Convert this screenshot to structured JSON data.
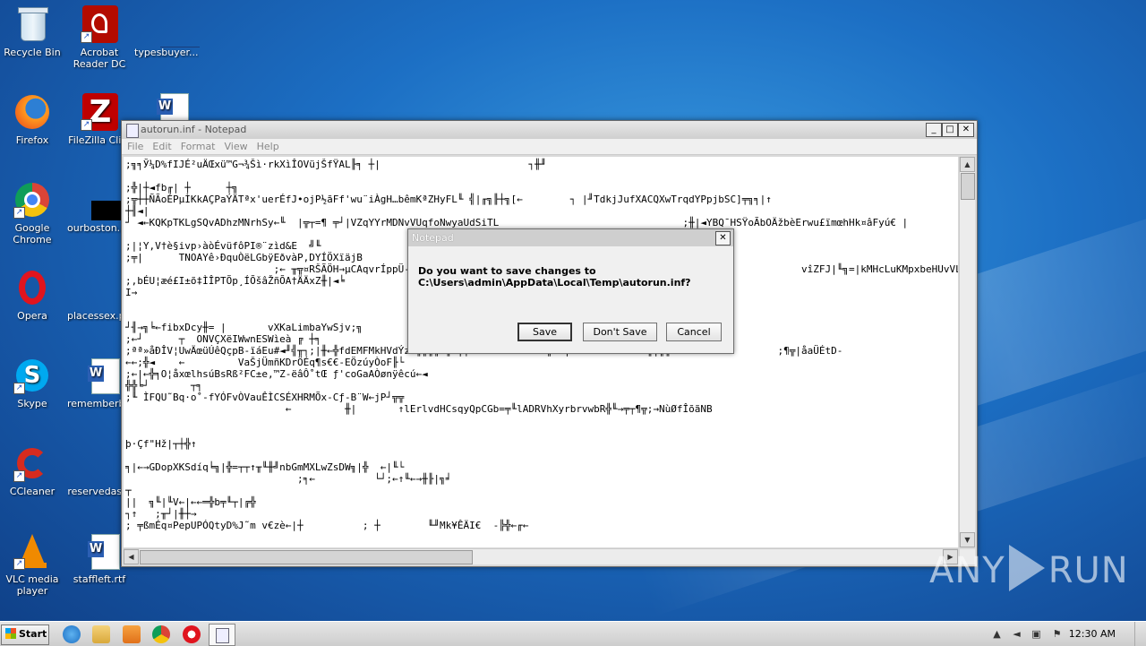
{
  "desktop": {
    "icons": [
      {
        "label": "Recycle Bin"
      },
      {
        "label": "Acrobat Reader DC"
      },
      {
        "label": "typesbuyer...."
      },
      {
        "label": "Firefox"
      },
      {
        "label": "FileZilla Cli..."
      },
      {
        "label": "Google Chrome"
      },
      {
        "label": "ourboston.r..."
      },
      {
        "label": "Opera"
      },
      {
        "label": "placessex.p..."
      },
      {
        "label": "Skype"
      },
      {
        "label": "rememberb..."
      },
      {
        "label": "CCleaner"
      },
      {
        "label": "reservedas..."
      },
      {
        "label": "VLC media player"
      },
      {
        "label": "staffleft.rtf"
      }
    ]
  },
  "notepad": {
    "title": "autorun.inf - Notepad",
    "menu": [
      "File",
      "Edit",
      "Format",
      "View",
      "Help"
    ],
    "content": ";╗╕Ў¼D%fIJÉ²uÄŒxü™G¬¾Šì·rkXìÎOVüjŠfŸAL╟╕ ┼|                         ┐╫╜\n\n;╬|┼◄fb╓| ┼      ┼╗\n;╦┼┼ÑÃoÉPµÌKkAÇPaÝÄTªx'uerÉfJ•ojP½ãFf'wu¨iÀgH…bêmKªZHyFL╙ ╣|╓╗╟┼╗[←        ┐ |╜TdkjJufXACQXwTrqdYPpjbSC]╤╗╕|↑\n┼╢◄|\n┘ ◄←KQKpTKLgSQvADhzMNrhSy←╙  |╦┬=¶ ╤┘|VZqYYrMDNvVUqfoNwyaUdSiTL                               ;╫|◄YBQ¯HSŸoÃbOÄžbèErwu£ïmœhHk¤âFyú€ |\n\n;|¦Y,V†è§ivp›àòÉvüfôPI®¨zìd&E  ╝╙\n;╤|      TNOAYê›ÐquÒëLGbÿEðvàP,DYÍÖXïäjB\n                         ;← ╥╦¤RŠÃÖH→µCAqvrÍppÜ-†EÑ                                                               vîZFJ|╙╗=|kMHcLuKMpxbeHUvVLDm╜\n;,bÉU¦æé£I±õ‡ÌÎPTÕp¸ÍÕšâŽñÕA†ÄÄxZ╫|◄╘\nI→\n\n\n┘╢→╗╘←fibxDcy╫= |       vXKaLimbaYwSjv;╗\n;←┘      ┬  ONVÇXëIWwnESWìeà ╔ ┼╕\n;ªª»åÐÎV¦UwÄœüÚêQçpB-ïáEu#◄╜╣╥┐;|╫←╬fdEMFMkHVdÝzE╫╣╫╬ ╬←|╤hNkoIumHmuk←◄╗ ←|=  →◄╜╜YeTJ←←╟|╗╥                  ;¶╦|åaÜÉtD-\n←←;╬◄    ←         VaŠjÜmñKDrÖÉq¶s€€-EÖzúyÒoF╟└\n;←|←╬╕O¦åxœlhsúBsRß²FC±e,™Z-ëâÔ˚tŒ ƒ'coGaAÒønÿêcú←◄\n╬╬╘┘       ┬╕\n;╙ ÌFQU˜Bq·o˚-fYÓFvÒVauÊÌCSÉXHRMÕx-Cƒ-B¨W←jP┘╦╦\n                           ←         ╫|       ↑lErlvdHCsqyQpCGb=╤╙lADRVhXyrbrvwbR╬╙→╤┬¶╦;→NùØfÎõãNB\n\n\nþ·Çf\"Hž|┬┼╬↑\n\n╕|←→GDopXKSdíq╘╗|╬=┬┬↑╥╙╫╝nbGmMXLwZsDW╗|╬  ←|╙└\n                             ;╕←          └┘;←↑╙←→╫╟|╗╛\n┬\n||  ╗╙|╙V←|←←═╬b╤╙┬|╔╬\n┐↑   ;╥┘|╫┼→\n; ╤ßmÉq¤PepUPÓQtyD%J˜m v€zè←|┼          ; ┼        ╙╜Mk¥ÊÄI€  -╠╬←╓←"
  },
  "dialog": {
    "title": "Notepad",
    "message_line1": "Do you want to save changes to",
    "message_line2": "C:\\Users\\admin\\AppData\\Local\\Temp\\autorun.inf?",
    "buttons": {
      "save": "Save",
      "dont_save": "Don't Save",
      "cancel": "Cancel"
    }
  },
  "taskbar": {
    "start_label": "Start",
    "clock": "12:30 AM"
  },
  "watermark": {
    "left": "ANY",
    "right": "RUN"
  }
}
